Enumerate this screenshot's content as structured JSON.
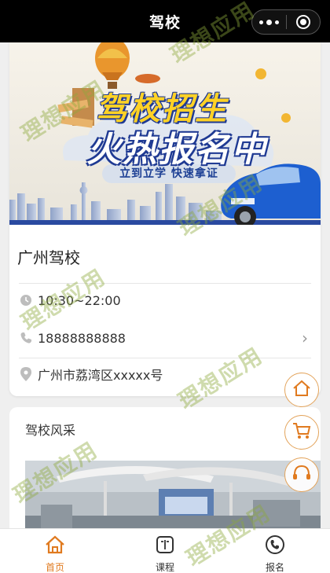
{
  "navbar": {
    "title": "驾校"
  },
  "banner": {
    "title_line1": "驾校招生",
    "title_line2": "火热报名中",
    "slogan": "立到立学  快速拿证"
  },
  "school": {
    "name": "广州驾校",
    "hours": "10:30~22:00",
    "phone": "18888888888",
    "address": "广州市荔湾区xxxxx号"
  },
  "gallery": {
    "title": "驾校风采"
  },
  "tabbar": {
    "items": [
      {
        "label": "首页",
        "icon": "home-icon",
        "active": true
      },
      {
        "label": "课程",
        "icon": "book-icon",
        "active": false
      },
      {
        "label": "报名",
        "icon": "phone-icon",
        "active": false
      }
    ]
  },
  "watermark": {
    "text": "理想应用"
  },
  "colors": {
    "accent": "#e07a1f",
    "navbar": "#000000",
    "banner_blue": "#1f3a93",
    "banner_yellow": "#ffd226"
  }
}
